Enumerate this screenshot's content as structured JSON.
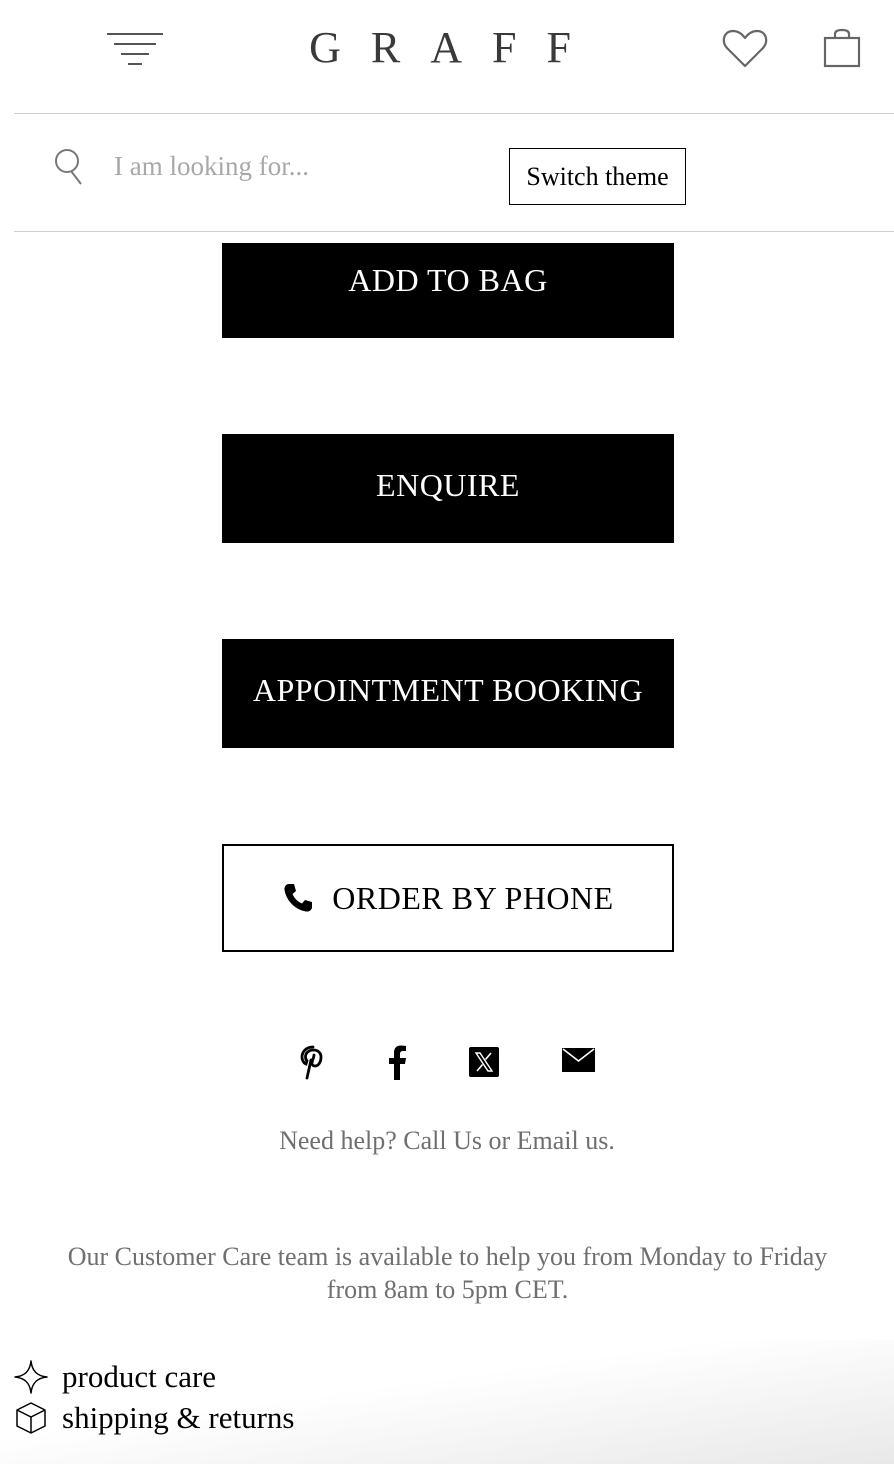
{
  "header": {
    "logo": "GRAFF",
    "menu_icon": "hamburger-menu-icon",
    "wishlist_icon": "heart-icon",
    "bag_icon": "shopping-bag-icon"
  },
  "search": {
    "placeholder": "I am looking for...",
    "icon": "search-icon",
    "switch_theme_label": "Switch theme"
  },
  "actions": {
    "add_to_bag": "ADD TO BAG",
    "enquire": "ENQUIRE",
    "appointment": "APPOINTMENT BOOKING",
    "order_by_phone": "ORDER BY PHONE"
  },
  "social": {
    "icons": [
      "pinterest-icon",
      "facebook-icon",
      "x-icon",
      "email-icon"
    ]
  },
  "help": {
    "need_help": "Need help? Call Us or Email us.",
    "customer_care": "Our Customer Care team is available to help you from Monday to Friday from 8am to 5pm CET."
  },
  "links": {
    "product_care": "product care",
    "shipping_returns": "shipping & returns"
  }
}
